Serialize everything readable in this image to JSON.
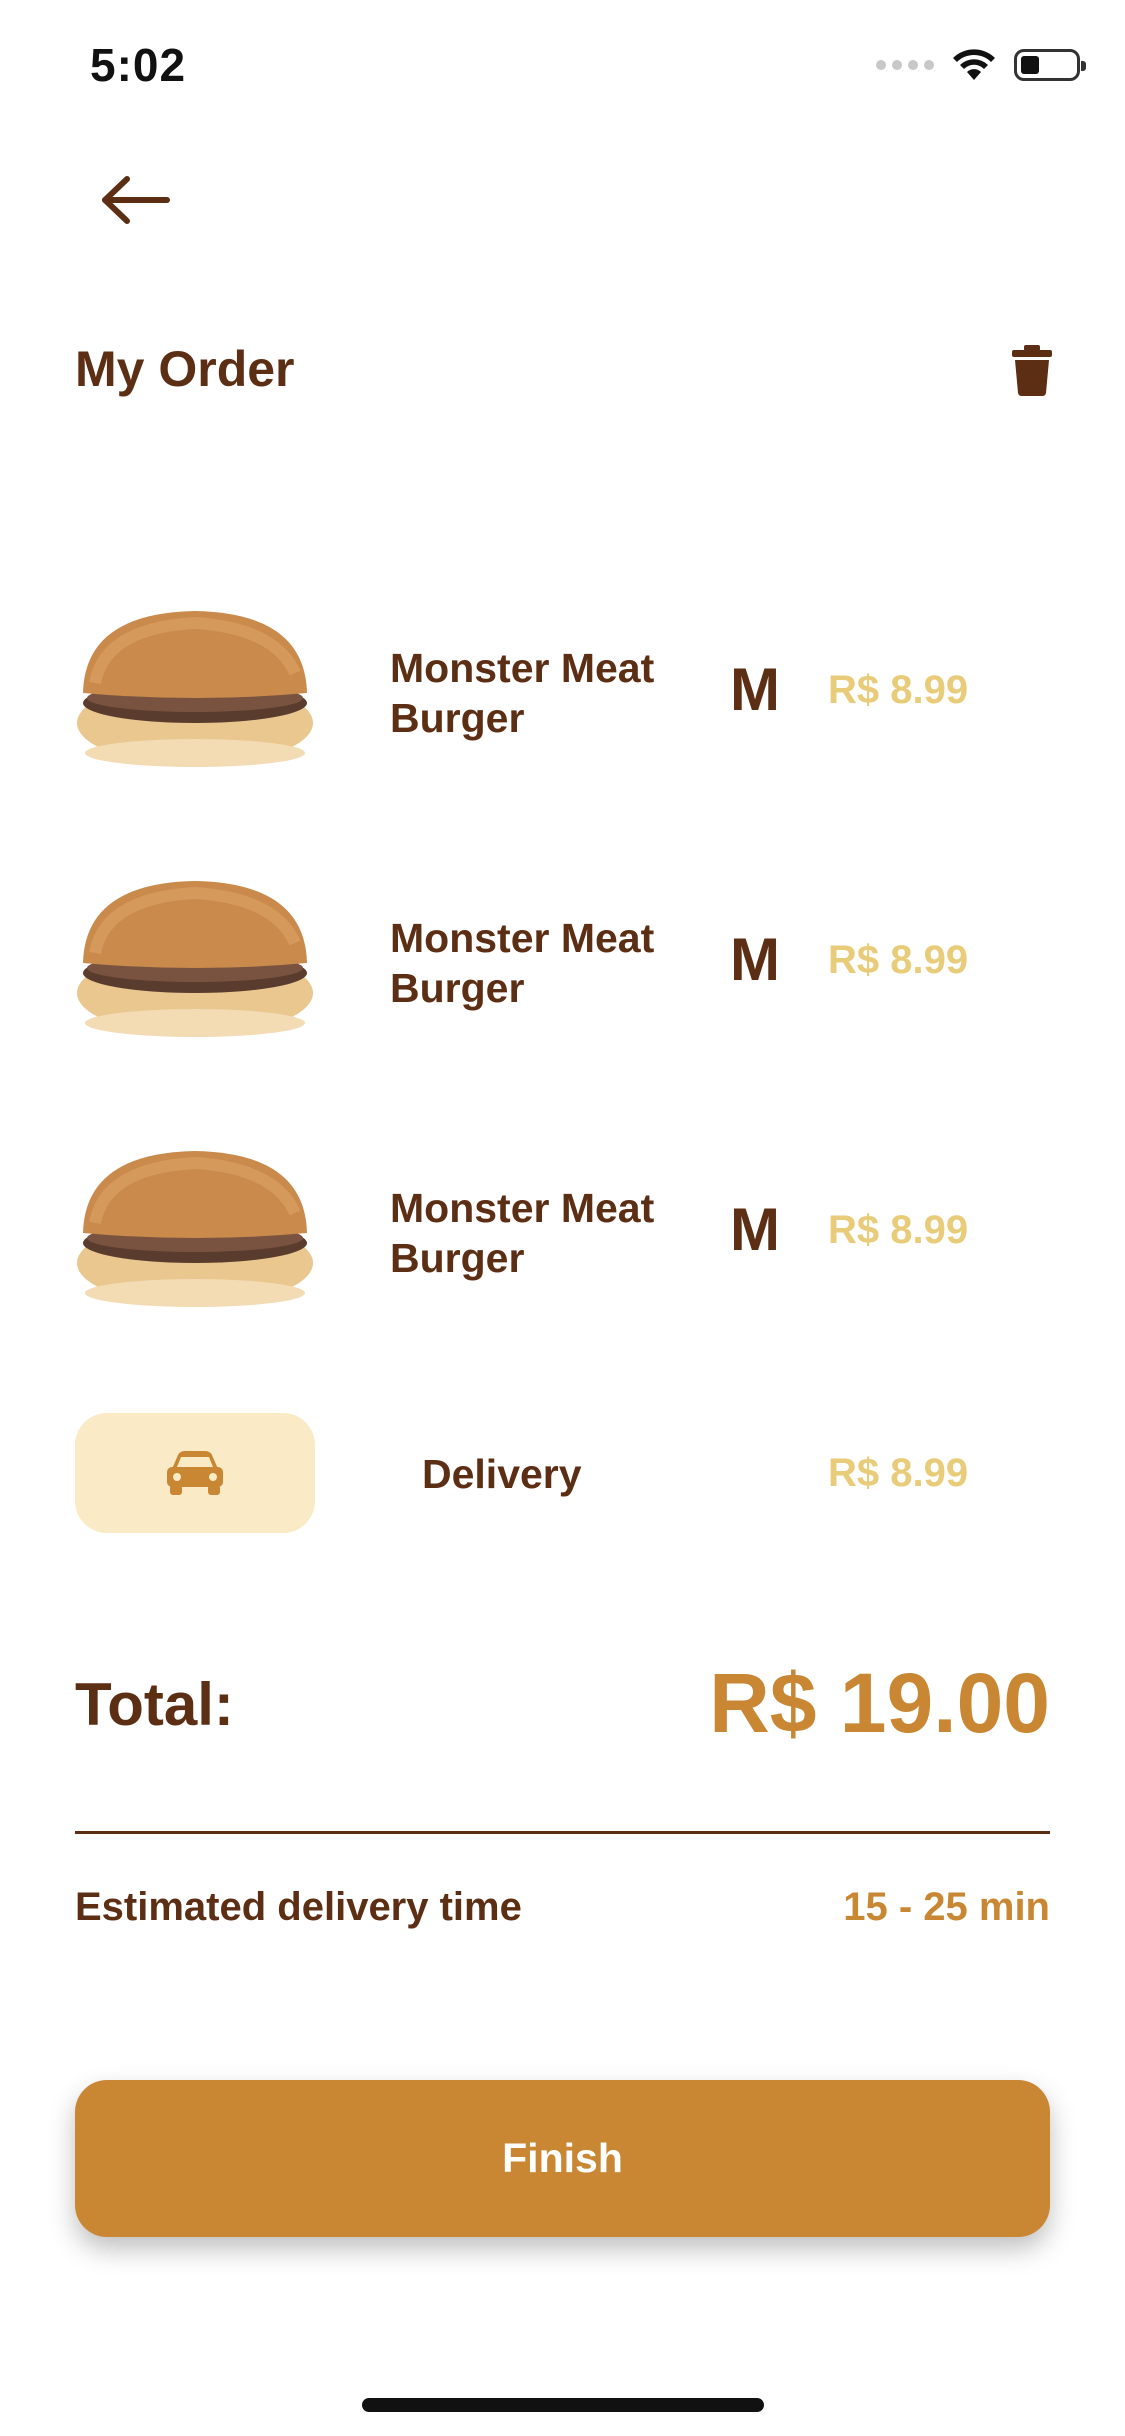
{
  "status_bar": {
    "time": "5:02",
    "icons": [
      "signal-icon",
      "wifi-icon",
      "battery-icon"
    ]
  },
  "header": {
    "back_icon": "arrow-left-icon",
    "title": "My Order",
    "clear_icon": "trash-icon"
  },
  "order": {
    "items": [
      {
        "name": "Monster Meat Burger",
        "size": "M",
        "price": "R$ 8.99",
        "image": "burger-image"
      },
      {
        "name": "Monster Meat Burger",
        "size": "M",
        "price": "R$ 8.99",
        "image": "burger-image"
      },
      {
        "name": "Monster Meat Burger",
        "size": "M",
        "price": "R$ 8.99",
        "image": "burger-image"
      }
    ],
    "delivery": {
      "icon": "car-icon",
      "label": "Delivery",
      "price": "R$ 8.99"
    }
  },
  "summary": {
    "total_label": "Total:",
    "total_value": "R$ 19.00",
    "eta_label": "Estimated delivery time",
    "eta_value": "15 - 25 min"
  },
  "actions": {
    "finish_label": "Finish"
  },
  "colors": {
    "primary": "#c98734",
    "text_dark": "#5c2e14",
    "price_light": "#e8cc7a",
    "delivery_chip": "#faeac5"
  }
}
